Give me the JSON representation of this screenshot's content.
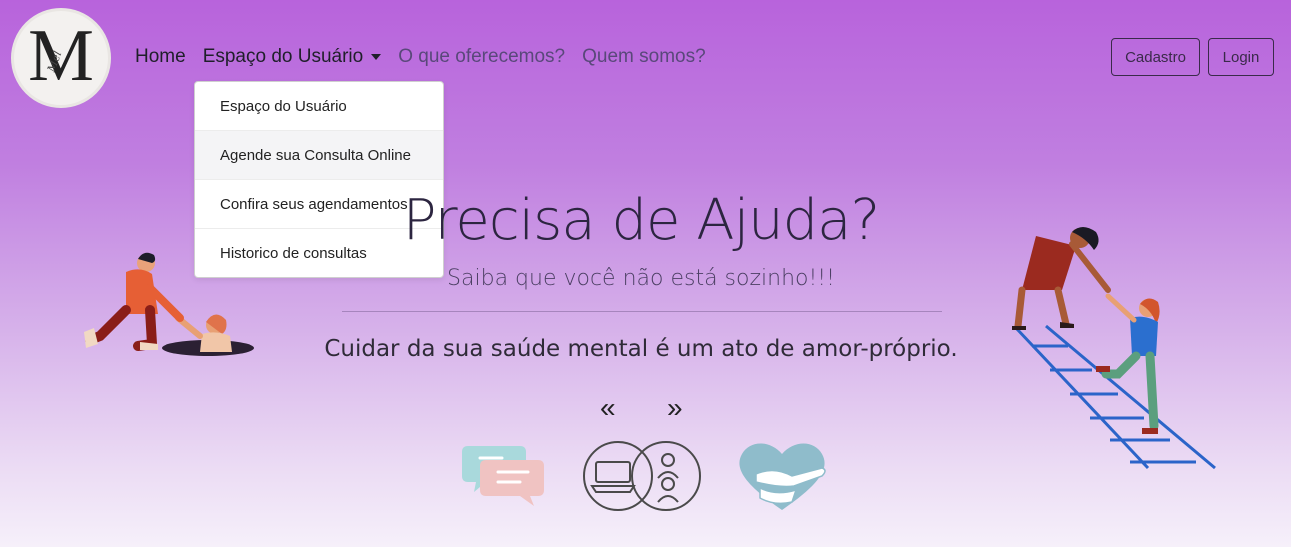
{
  "brand": {
    "logo_letter": "M",
    "logo_signature": "Mel"
  },
  "nav": {
    "home": "Home",
    "user_space": "Espaço do Usuário",
    "offer": "O que oferecemos?",
    "about": "Quem somos?"
  },
  "auth": {
    "signup": "Cadastro",
    "login": "Login"
  },
  "dropdown": {
    "items": [
      {
        "label": "Espaço do Usuário"
      },
      {
        "label": "Agende sua Consulta Online"
      },
      {
        "label": "Confira seus agendamentos"
      },
      {
        "label": "Historico de consultas"
      }
    ]
  },
  "hero": {
    "title": "Precisa de Ajuda?",
    "subtitle": "Saiba que você não está sozinho!!!",
    "tagline": "Cuidar da sua saúde mental é um ato de amor-próprio."
  },
  "carousel": {
    "prev": "«",
    "next": "»"
  },
  "icons": {
    "left_illustration": "helping-hand-illustration",
    "right_illustration": "ladder-help-illustration",
    "feature_1": "chat-bubbles-icon",
    "feature_2": "online-consultation-icon",
    "feature_3": "heart-hands-icon"
  },
  "colors": {
    "accent": "#b863dc",
    "text_dark": "#2c2540"
  }
}
